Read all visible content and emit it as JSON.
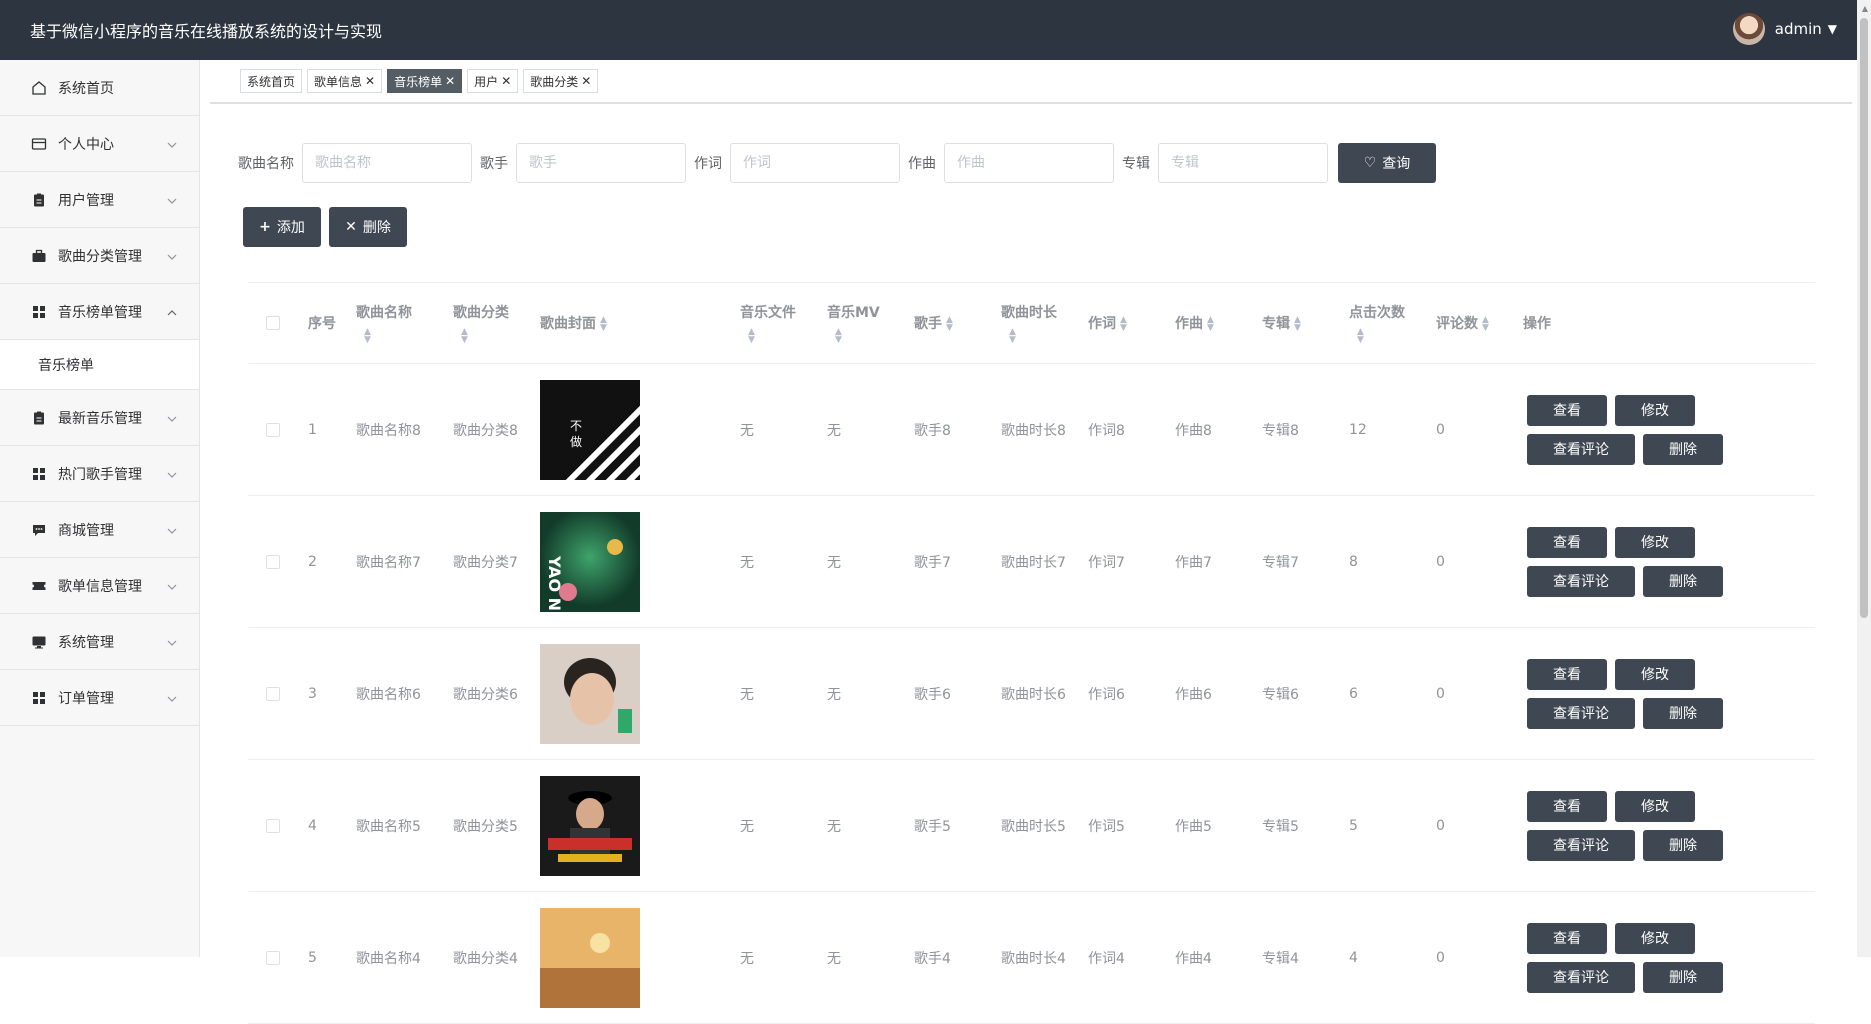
{
  "app": {
    "title": "基于微信小程序的音乐在线播放系统的设计与实现",
    "user": "admin"
  },
  "sidebar": {
    "items": [
      {
        "label": "系统首页",
        "icon": "home-icon",
        "chevron": false
      },
      {
        "label": "个人中心",
        "icon": "card-icon",
        "chevron": true
      },
      {
        "label": "用户管理",
        "icon": "clipboard-icon",
        "chevron": true
      },
      {
        "label": "歌曲分类管理",
        "icon": "briefcase-icon",
        "chevron": true
      },
      {
        "label": "音乐榜单管理",
        "icon": "grid-icon",
        "chevron": true,
        "open": true
      },
      {
        "label": "最新音乐管理",
        "icon": "clipboard-icon",
        "chevron": true
      },
      {
        "label": "热门歌手管理",
        "icon": "grid-icon",
        "chevron": true
      },
      {
        "label": "商城管理",
        "icon": "chat-icon",
        "chevron": true
      },
      {
        "label": "歌单信息管理",
        "icon": "ticket-icon",
        "chevron": true
      },
      {
        "label": "系统管理",
        "icon": "monitor-icon",
        "chevron": true
      },
      {
        "label": "订单管理",
        "icon": "grid-icon",
        "chevron": true
      }
    ],
    "submenu": {
      "label": "音乐榜单"
    }
  },
  "tabs": [
    {
      "label": "系统首页",
      "closable": false,
      "active": false
    },
    {
      "label": "歌单信息",
      "closable": true,
      "active": false
    },
    {
      "label": "音乐榜单",
      "closable": true,
      "active": true
    },
    {
      "label": "用户",
      "closable": true,
      "active": false
    },
    {
      "label": "歌曲分类",
      "closable": true,
      "active": false
    }
  ],
  "search": {
    "fields": [
      {
        "label": "歌曲名称",
        "placeholder": "歌曲名称"
      },
      {
        "label": "歌手",
        "placeholder": "歌手"
      },
      {
        "label": "作词",
        "placeholder": "作词"
      },
      {
        "label": "作曲",
        "placeholder": "作曲"
      },
      {
        "label": "专辑",
        "placeholder": "专辑"
      }
    ],
    "button": "查询"
  },
  "actions": {
    "add": "添加",
    "delete": "删除"
  },
  "table": {
    "headers": {
      "idx": "序号",
      "name": "歌曲名称",
      "cat": "歌曲分类",
      "cover": "歌曲封面",
      "file": "音乐文件",
      "mv": "音乐MV",
      "singer": "歌手",
      "dur": "歌曲时长",
      "lyr": "作词",
      "comp": "作曲",
      "album": "专辑",
      "clicks": "点击次数",
      "comments": "评论数",
      "ops": "操作"
    },
    "row_buttons": {
      "view": "查看",
      "edit": "修改",
      "view_comments": "查看评论",
      "delete": "删除"
    },
    "rows": [
      {
        "idx": "1",
        "name": "歌曲名称8",
        "cat": "歌曲分类8",
        "file": "无",
        "mv": "无",
        "singer": "歌手8",
        "dur": "歌曲时长8",
        "lyr": "作词8",
        "comp": "作曲8",
        "album": "专辑8",
        "clicks": "12",
        "comments": "0",
        "cover": "cover-stripes"
      },
      {
        "idx": "2",
        "name": "歌曲名称7",
        "cat": "歌曲分类7",
        "file": "无",
        "mv": "无",
        "singer": "歌手7",
        "dur": "歌曲时长7",
        "lyr": "作词7",
        "comp": "作曲7",
        "album": "专辑7",
        "clicks": "8",
        "comments": "0",
        "cover": "cover-green"
      },
      {
        "idx": "3",
        "name": "歌曲名称6",
        "cat": "歌曲分类6",
        "file": "无",
        "mv": "无",
        "singer": "歌手6",
        "dur": "歌曲时长6",
        "lyr": "作词6",
        "comp": "作曲6",
        "album": "专辑6",
        "clicks": "6",
        "comments": "0",
        "cover": "cover-portrait"
      },
      {
        "idx": "4",
        "name": "歌曲名称5",
        "cat": "歌曲分类5",
        "file": "无",
        "mv": "无",
        "singer": "歌手5",
        "dur": "歌曲时长5",
        "lyr": "作词5",
        "comp": "作曲5",
        "album": "专辑5",
        "clicks": "5",
        "comments": "0",
        "cover": "cover-hat"
      },
      {
        "idx": "5",
        "name": "歌曲名称4",
        "cat": "歌曲分类4",
        "file": "无",
        "mv": "无",
        "singer": "歌手4",
        "dur": "歌曲时长4",
        "lyr": "作词4",
        "comp": "作曲4",
        "album": "专辑4",
        "clicks": "4",
        "comments": "0",
        "cover": "cover-sunset"
      }
    ]
  },
  "colors": {
    "topbar": "#2d3540",
    "button": "#3e4752",
    "active_tab": "#545c64"
  }
}
